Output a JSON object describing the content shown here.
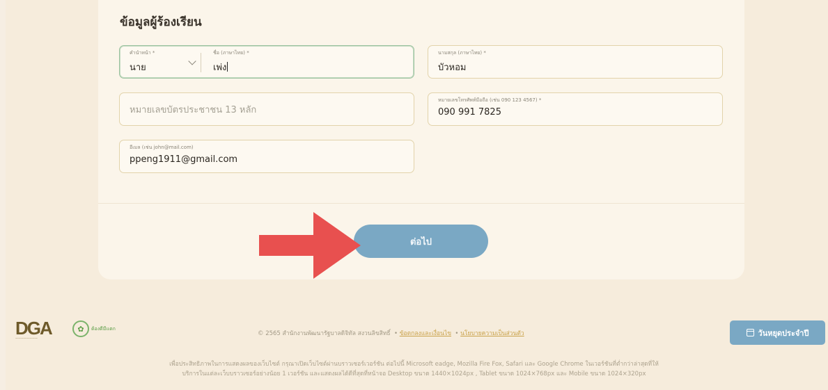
{
  "form": {
    "section_title": "ข้อมูลผู้ร้องเรียน",
    "title_prefix": {
      "label": "คำนำหน้า *",
      "value": "นาย"
    },
    "first_name": {
      "label": "ชื่อ (ภาษาไทย) *",
      "value": "เพ่ง"
    },
    "last_name": {
      "label": "นามสกุล (ภาษาไทย) *",
      "value": "บัวหอม"
    },
    "id_card": {
      "placeholder": "หมายเลขบัตรประชาชน 13 หลัก"
    },
    "phone": {
      "label": "หมายเลขโทรศัพท์มือถือ (เช่น 090 123 4567) *",
      "value": "090 991 7825"
    },
    "email": {
      "label": "อีเมล (เช่น john@mail.com)",
      "value": "ppeng1911@gmail.com"
    },
    "next_label": "ต่อไป"
  },
  "footer": {
    "dga_logo_text": "DGA",
    "partner_logo_text": "ต้องดีมีเเตก",
    "copyright": "© 2565 สำนักงานพัฒนารัฐบาลดิจิทัล สงวนลิขสิทธิ์",
    "terms_link": "ข้อตกลงและเงื่อนไข",
    "privacy_link": "นโยบายความเป็นส่วนตัว",
    "holiday_button": "วันหยุดประจำปี",
    "note_line1": "เพื่อประสิทธิภาพในการแสดงผลของเว็บไซต์ กรุณาเปิดเว็บไซต์ผ่านบราวเซอร์เวอร์ชัน ต่อไปนี้ Microsoft eadge, Mozilla Fire Fox, Safari และ Google Chrome ในเวอร์ชันที่ต่ำกว่าล่าสุดที่ให้",
    "note_line2": "บริการในแต่ละเว็บบราวเซอร์อย่างน้อย 1 เวอร์ชัน และแสดงผลได้ดีที่สุดที่หน้าจอ Desktop ขนาด 1440×1024px , Tablet ขนาด 1024×768px และ Mobile ขนาด 1024×320px"
  },
  "colors": {
    "primary_button": "#7aa8c4",
    "arrow": "#e8504f",
    "background": "#f6ecdc"
  },
  "icons": {
    "dropdown": "chevron-down-icon",
    "holiday": "calendar-check-icon",
    "annotation": "red-arrow-right-icon"
  }
}
